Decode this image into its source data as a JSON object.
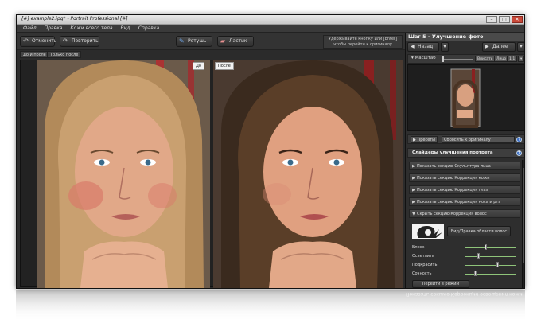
{
  "window": {
    "title": "[#] example2.jpg* - Portrait Professional [#]",
    "controls": [
      "–",
      "□",
      "✕"
    ]
  },
  "menu": [
    "Файл",
    "Правка",
    "Кожи всего тела",
    "Вид",
    "Справка"
  ],
  "toolbar": {
    "undo_label": "Отменить",
    "redo_label": "Повторить",
    "retouch_label": "Ретушь",
    "eraser_label": "Ластик",
    "hint_line1": "Удерживайте кнопку или [Enter]",
    "hint_line2": "чтобы перейти к оригиналу"
  },
  "view_tabs": [
    "До и после",
    "Только после"
  ],
  "photos": {
    "before_label": "До",
    "after_label": "После"
  },
  "panel": {
    "step_title": "Шаг 5 - Улучшение фото",
    "back_label": "Назад",
    "next_label": "Далее",
    "zoom_label": "Масштаб",
    "zoom_buttons": [
      "Вписать",
      "Лицо",
      "1:1"
    ],
    "presets_label": "Пресеты",
    "reset_label": "Сбросить к оригиналу",
    "sliders_title": "Слайдеры улучшения портрета",
    "sections": [
      "Показать секцию Скульптура лица",
      "Показать секцию Коррекция кожи",
      "Показать секцию Коррекция глаз",
      "Показать секцию Коррекция носа и рта",
      "Скрыть секцию Коррекция волос"
    ],
    "hair_view_label": "Вид/Правка области волос",
    "sliders": [
      {
        "label": "Блеск",
        "value": 0.4
      },
      {
        "label": "Осветлить",
        "value": 0.25
      },
      {
        "label": "Подкрасить",
        "value": 0.65
      },
      {
        "label": "Сочность",
        "value": 0.2
      }
    ],
    "hair_mode_label": "Перейти в режим прически",
    "bottom_section": "Показать секцию Коррекция освещения кожи"
  },
  "colors": {
    "accent_blue": "#3c70c8",
    "slider_track": "#8fc47a",
    "close_red": "#c94a3a"
  }
}
